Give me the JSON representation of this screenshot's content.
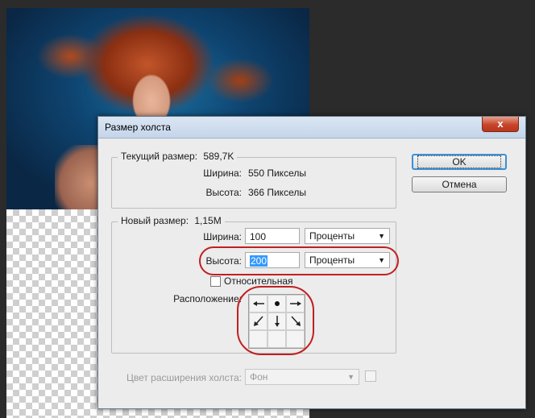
{
  "dialog": {
    "title": "Размер холста",
    "close_label": "x",
    "current_size": {
      "legend_label": "Текущий размер:",
      "legend_value": "589,7K",
      "width_label": "Ширина:",
      "width_value": "550 Пикселы",
      "height_label": "Высота:",
      "height_value": "366 Пикселы"
    },
    "new_size": {
      "legend_label": "Новый размер:",
      "legend_value": "1,15M",
      "width_label": "Ширина:",
      "width_value": "100",
      "width_unit": "Проценты",
      "height_label": "Высота:",
      "height_value": "200",
      "height_unit": "Проценты",
      "relative_label": "Относительная",
      "relative_checked": false,
      "anchor_label": "Расположение:"
    },
    "canvas_ext": {
      "label": "Цвет расширения холста:",
      "value": "Фон"
    },
    "buttons": {
      "ok": "OK",
      "cancel": "Отмена"
    }
  },
  "icons": {
    "anchor": [
      "arrow-left-icon",
      "anchor-dot-icon",
      "arrow-right-icon",
      "arrow-down-left-icon",
      "arrow-down-icon",
      "arrow-down-right-icon",
      "",
      "",
      ""
    ]
  },
  "colors": {
    "highlight_ring": "#c21f1f",
    "selection": "#3399ff",
    "default_button_border": "#3c8fd6"
  }
}
